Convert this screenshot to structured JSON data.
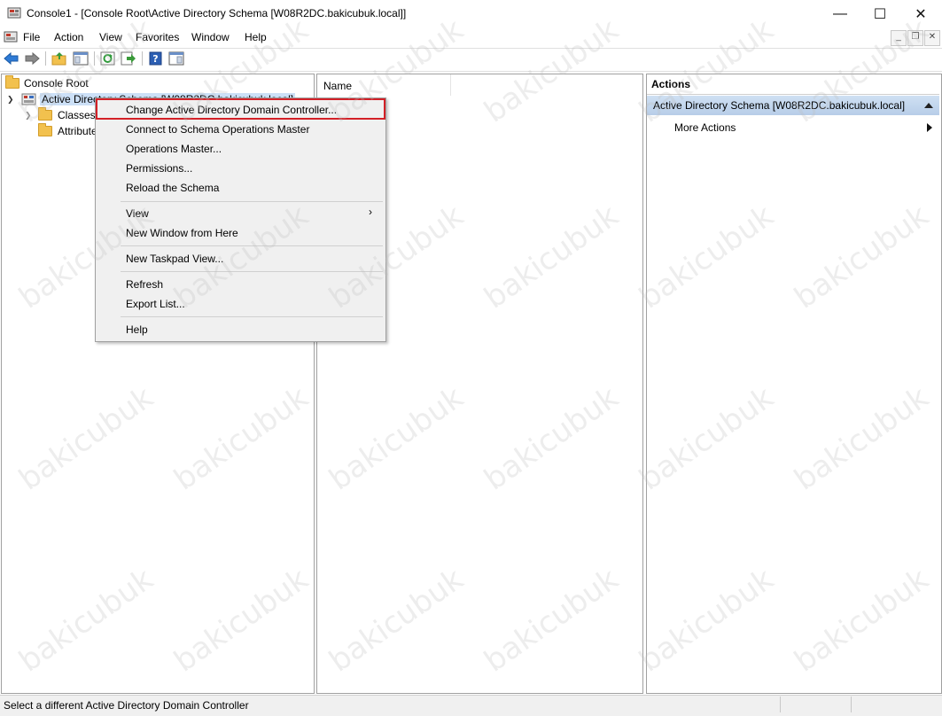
{
  "window": {
    "title": "Console1 - [Console Root\\Active Directory Schema [W08R2DC.bakicubuk.local]]",
    "minimize": "—",
    "maximize": "☐",
    "close": "✕"
  },
  "menubar": {
    "items": [
      "File",
      "Action",
      "View",
      "Favorites",
      "Window",
      "Help"
    ],
    "mdi_minimize": "_",
    "mdi_restore": "❐",
    "mdi_close": "✕"
  },
  "toolbar": {
    "icons": [
      "back-icon",
      "forward-icon",
      "up-folder-icon",
      "show-hide-tree-icon",
      "refresh-icon",
      "export-list-icon",
      "help-icon",
      "show-hide-action-pane-icon"
    ]
  },
  "tree": {
    "root": "Console Root",
    "schema": "Active Directory Schema [W08R2DC.bakicubuk.local]",
    "classes": "Classes",
    "attributes": "Attributes"
  },
  "list": {
    "column_name": "Name"
  },
  "actions": {
    "header": "Actions",
    "group": "Active Directory Schema [W08R2DC.bakicubuk.local]",
    "more_actions": "More Actions"
  },
  "context_menu": {
    "items": [
      "Change Active Directory Domain Controller...",
      "Connect to Schema Operations Master",
      "Operations Master...",
      "Permissions...",
      "Reload the Schema",
      "View",
      "New Window from Here",
      "New Taskpad View...",
      "Refresh",
      "Export List...",
      "Help"
    ]
  },
  "statusbar": {
    "text": "Select a different Active Directory Domain Controller"
  },
  "watermark": "bakicubuk",
  "colors": {
    "highlight_border": "#d32027",
    "actions_group_bg": "#c4d7ee",
    "folder": "#f2c14e"
  }
}
